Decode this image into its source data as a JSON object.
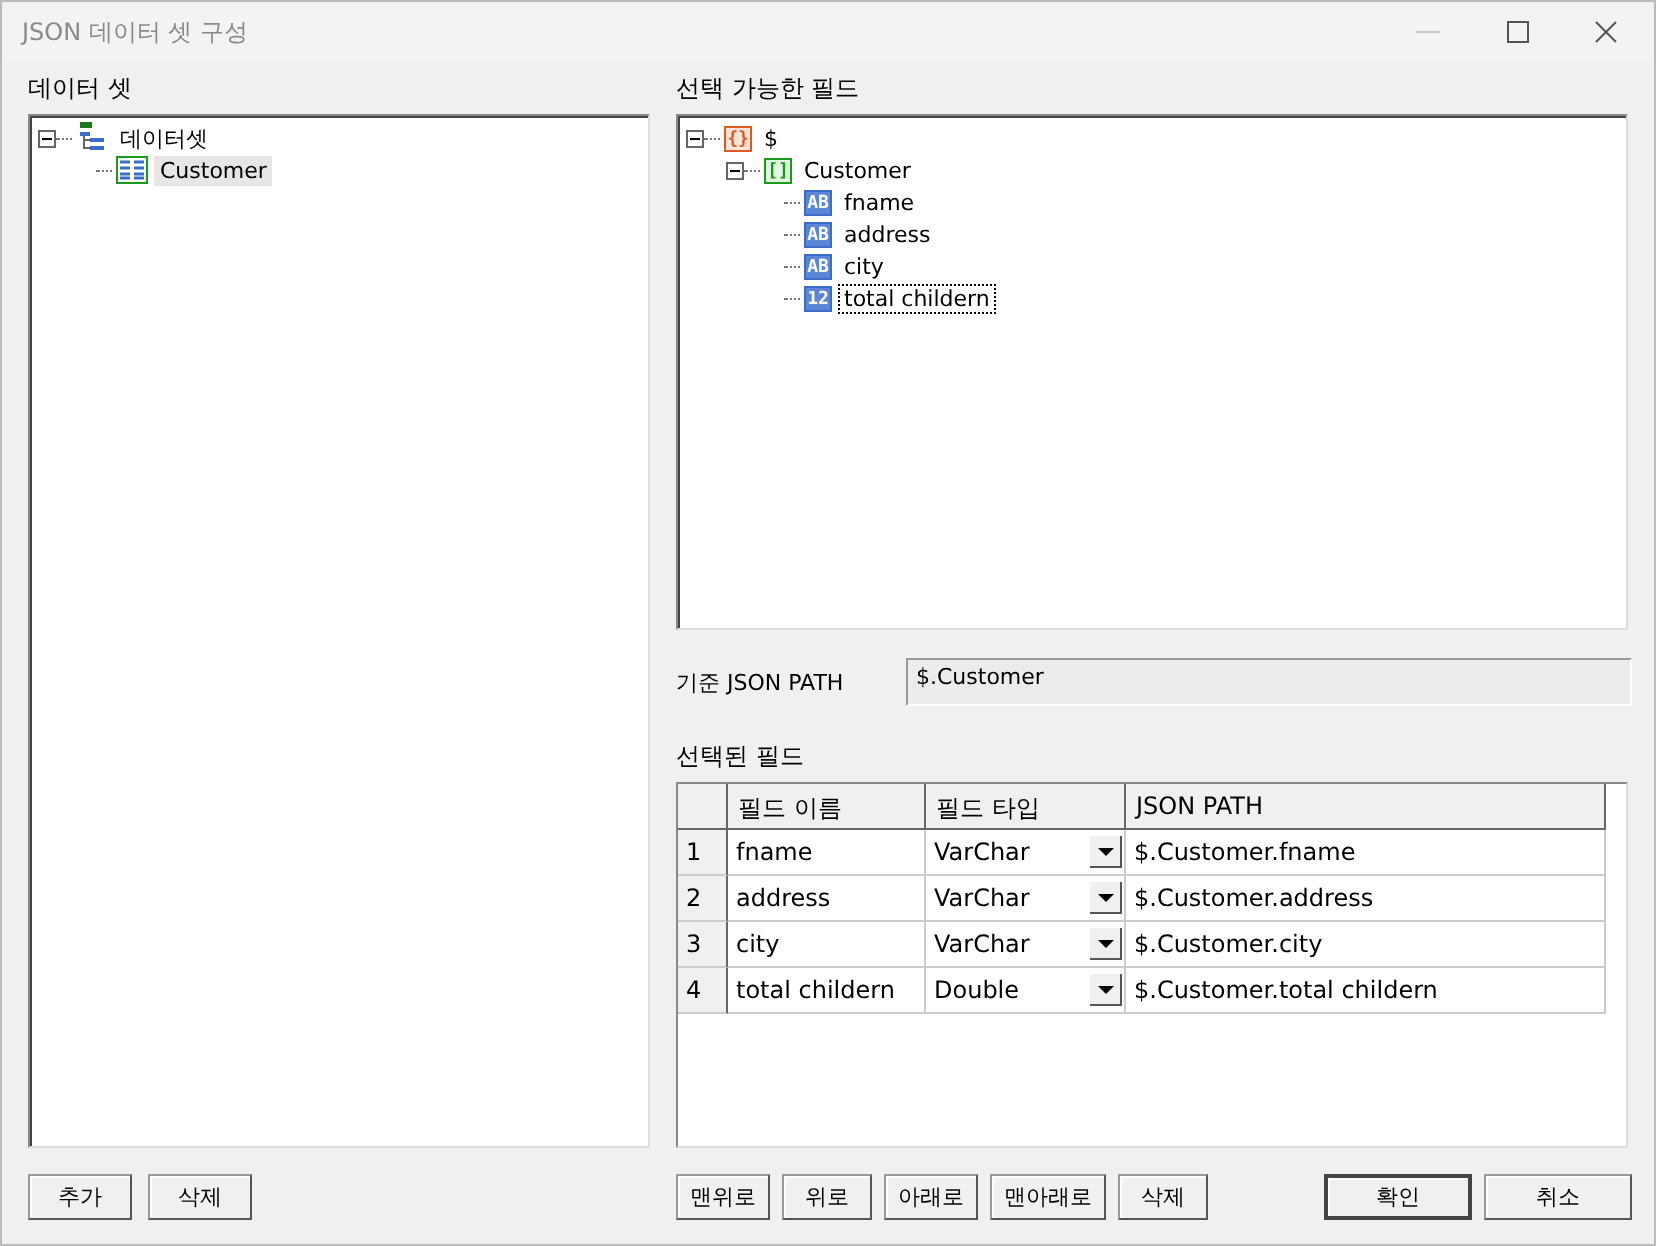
{
  "window": {
    "title": "JSON 데이터 셋 구성"
  },
  "dataset_panel": {
    "label": "데이터 셋",
    "tree": [
      {
        "label": "데이터셋",
        "kind": "dataset",
        "expanded": true,
        "selected": false,
        "children": [
          {
            "label": "Customer",
            "kind": "table",
            "selected": true
          }
        ]
      }
    ]
  },
  "fields_panel": {
    "label": "선택 가능한 필드",
    "tree": [
      {
        "label": "$",
        "kind": "object",
        "glyph": "{}",
        "expanded": true,
        "focused": false,
        "children": [
          {
            "label": "Customer",
            "kind": "array",
            "glyph": "[]",
            "expanded": true,
            "focused": false,
            "children": [
              {
                "label": "fname",
                "kind": "field",
                "glyph": "AB",
                "focused": false
              },
              {
                "label": "address",
                "kind": "field",
                "glyph": "AB",
                "focused": false
              },
              {
                "label": "city",
                "kind": "field",
                "glyph": "AB",
                "focused": false
              },
              {
                "label": "total childern",
                "kind": "field",
                "glyph": "12",
                "focused": true
              }
            ]
          }
        ]
      }
    ]
  },
  "base_path": {
    "label": "기준 JSON PATH",
    "value": "$.Customer"
  },
  "selected_fields": {
    "label": "선택된 필드",
    "columns": [
      "필드 이름",
      "필드 타입",
      "JSON PATH"
    ],
    "rows": [
      {
        "index": "1",
        "name": "fname",
        "type": "VarChar",
        "path": "$.Customer.fname"
      },
      {
        "index": "2",
        "name": "address",
        "type": "VarChar",
        "path": "$.Customer.address"
      },
      {
        "index": "3",
        "name": "city",
        "type": "VarChar",
        "path": "$.Customer.city"
      },
      {
        "index": "4",
        "name": "total childern",
        "type": "Double",
        "path": "$.Customer.total childern"
      }
    ]
  },
  "left_buttons": [
    "추가",
    "삭제"
  ],
  "move_buttons": [
    "맨위로",
    "위로",
    "아래로",
    "맨아래로",
    "삭제"
  ],
  "dialog_buttons": [
    {
      "label": "확인",
      "default": true
    },
    {
      "label": "취소",
      "default": false
    }
  ]
}
